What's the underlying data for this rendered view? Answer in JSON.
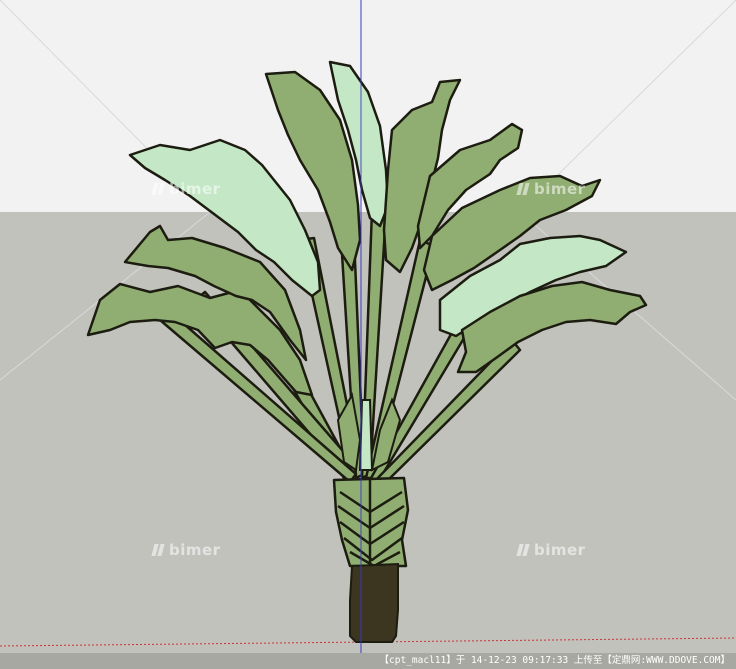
{
  "viewport": {
    "sky_color": "#f2f2f2",
    "ground_color": "#c2c2bd",
    "leaf_dark_color": "#90ae72",
    "leaf_light_color": "#c4e8c6",
    "trunk_color": "#3c3520",
    "axis_blue_color": "#3a3ac8",
    "axis_red_color": "#cc3333"
  },
  "watermarks": [
    {
      "text": "bimer"
    },
    {
      "text": "bimer"
    },
    {
      "text": "bimer"
    },
    {
      "text": "bimer"
    }
  ],
  "status_bar": {
    "text": "【cpt_macl11】于 14-12-23 09:17:33 上传至【定鼎网:WWW.DDOVE.COM】"
  }
}
